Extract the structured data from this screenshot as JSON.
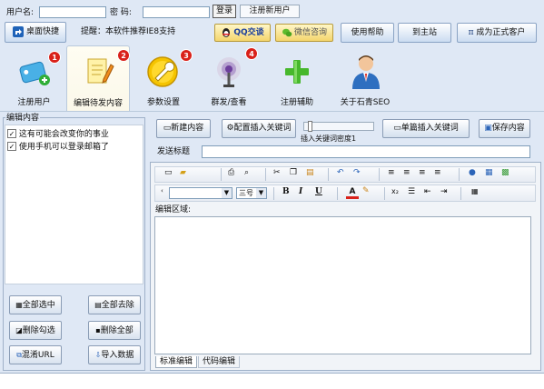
{
  "login": {
    "username_label": "用户名:",
    "password_label": "密  码:",
    "login_button": "登录",
    "register_button": "注册新用户"
  },
  "toolbar": {
    "desktop_shortcut": "桌面快捷",
    "hint": "提醒：本软件推荐IE8支持",
    "qq_chat": "QQ交谈",
    "wechat": "微信咨询",
    "help": "使用帮助",
    "home": "到主站",
    "become_customer": "成为正式客户"
  },
  "tabs": [
    {
      "label": "注册用户",
      "badge": "1"
    },
    {
      "label": "编辑待发内容",
      "badge": "2"
    },
    {
      "label": "参数设置",
      "badge": "3"
    },
    {
      "label": "群发/查看",
      "badge": "4"
    },
    {
      "label": "注册辅助"
    },
    {
      "label": "关于石青SEO"
    }
  ],
  "left_panel": {
    "title": "编辑内容",
    "items": [
      {
        "text": "这有可能会改变你的事业",
        "checked": true
      },
      {
        "text": "使用手机可以登录邮箱了",
        "checked": true
      }
    ],
    "buttons": {
      "select_all": "全部选中",
      "deselect_all": "全部去除",
      "delete_checked": "删除勾选",
      "delete_all": "删除全部",
      "mix_url": "混淆URL",
      "import_data": "导入数据"
    }
  },
  "editor": {
    "new_content": "新建内容",
    "insert_keywords": "配置插入关键词",
    "slider_label": "插入关键词密度1",
    "slider_value": 0.05,
    "single_insert": "单篇插入关键词",
    "save": "保存内容",
    "send_title_label": "发送标题",
    "font_size": "三号",
    "bold": "B",
    "italic": "I",
    "underline": "U",
    "edit_area_label": "编辑区域:",
    "tab_standard": "标准编辑",
    "tab_code": "代码编辑"
  },
  "colors": {
    "background": "#dfe8f5",
    "tab_active": "#fefff4",
    "badge": "#d9211a",
    "button_gradient_end": "#cbdcf1"
  }
}
